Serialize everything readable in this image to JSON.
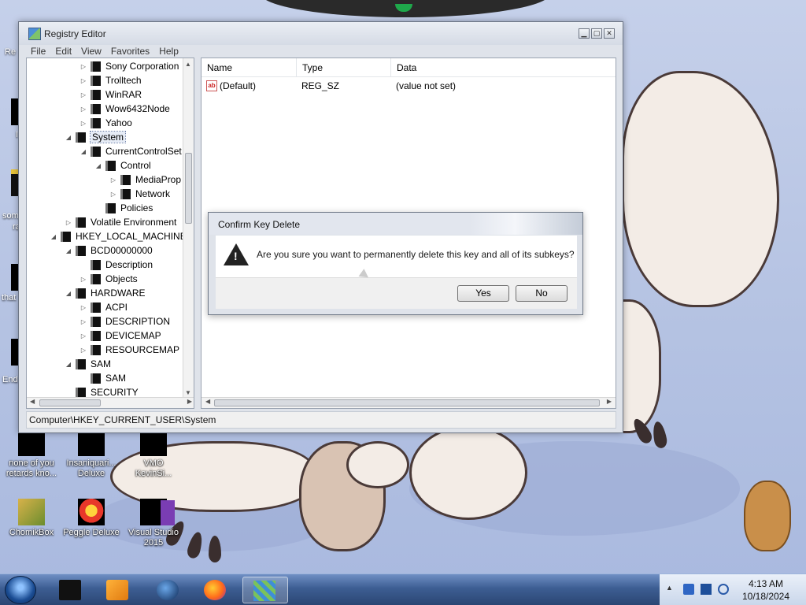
{
  "desktop": {
    "icons": [
      {
        "label_line1": "none of you",
        "label_line2": "retards kno...",
        "kind": "generic"
      },
      {
        "label_line1": "Insaniquari...",
        "label_line2": "Deluxe",
        "kind": "generic"
      },
      {
        "label_line1": "VMO",
        "label_line2": "KevinSi...",
        "kind": "generic"
      },
      {
        "label_line1": "ChomikBox",
        "label_line2": "",
        "kind": "gb"
      },
      {
        "label_line1": "Peggle Deluxe",
        "label_line2": "",
        "kind": "peggle"
      },
      {
        "label_line1": "Visual Studio",
        "label_line2": "2015",
        "kind": "vs"
      }
    ],
    "side_labels": [
      "Re",
      "I",
      "som",
      "ra",
      "that",
      "End"
    ]
  },
  "regedit": {
    "title": "Registry Editor",
    "menu": [
      "File",
      "Edit",
      "View",
      "Favorites",
      "Help"
    ],
    "tree": [
      {
        "label": "Sony Corporation",
        "level": 3,
        "exp": "▷"
      },
      {
        "label": "Trolltech",
        "level": 3,
        "exp": "▷"
      },
      {
        "label": "WinRAR",
        "level": 3,
        "exp": "▷"
      },
      {
        "label": "Wow6432Node",
        "level": 3,
        "exp": "▷"
      },
      {
        "label": "Yahoo",
        "level": 3,
        "exp": "▷"
      },
      {
        "label": "System",
        "level": 2,
        "exp": "◢",
        "selected": true
      },
      {
        "label": "CurrentControlSet",
        "level": 3,
        "exp": "◢"
      },
      {
        "label": "Control",
        "level": 4,
        "exp": "◢"
      },
      {
        "label": "MediaProp",
        "level": 5,
        "exp": "▷"
      },
      {
        "label": "Network",
        "level": 5,
        "exp": "▷"
      },
      {
        "label": "Policies",
        "level": 4,
        "exp": ""
      },
      {
        "label": "Volatile Environment",
        "level": 2,
        "exp": "▷"
      },
      {
        "label": "HKEY_LOCAL_MACHINE",
        "level": 1,
        "exp": "◢"
      },
      {
        "label": "BCD00000000",
        "level": 2,
        "exp": "◢"
      },
      {
        "label": "Description",
        "level": 3,
        "exp": ""
      },
      {
        "label": "Objects",
        "level": 3,
        "exp": "▷"
      },
      {
        "label": "HARDWARE",
        "level": 2,
        "exp": "◢"
      },
      {
        "label": "ACPI",
        "level": 3,
        "exp": "▷"
      },
      {
        "label": "DESCRIPTION",
        "level": 3,
        "exp": "▷"
      },
      {
        "label": "DEVICEMAP",
        "level": 3,
        "exp": "▷"
      },
      {
        "label": "RESOURCEMAP",
        "level": 3,
        "exp": "▷"
      },
      {
        "label": "SAM",
        "level": 2,
        "exp": "◢"
      },
      {
        "label": "SAM",
        "level": 3,
        "exp": ""
      },
      {
        "label": "SECURITY",
        "level": 2,
        "exp": ""
      }
    ],
    "columns": {
      "name": "Name",
      "type": "Type",
      "data": "Data"
    },
    "values": [
      {
        "name": "(Default)",
        "type": "REG_SZ",
        "data": "(value not set)"
      }
    ],
    "status": "Computer\\HKEY_CURRENT_USER\\System"
  },
  "dialog": {
    "title": "Confirm Key Delete",
    "message": "Are you sure you want to permanently delete this key and all of its subkeys?",
    "yes_label": "Yes",
    "no_label": "No"
  },
  "taskbar": {
    "apps": [
      "file-explorer",
      "media-player",
      "web-browser",
      "firefox",
      "registry-editor"
    ],
    "active_app": "registry-editor",
    "time": "4:13 AM",
    "date": "10/18/2024"
  }
}
